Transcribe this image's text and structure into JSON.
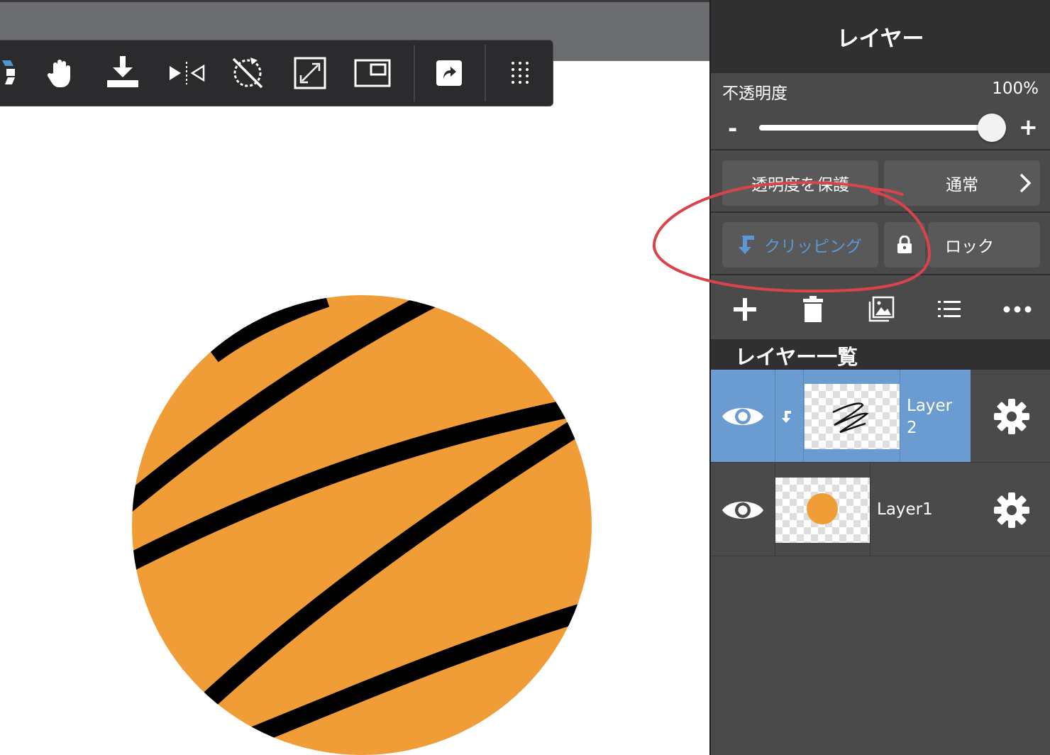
{
  "canvas": {
    "fill_color": "#f09d38",
    "stroke_color": "#000000",
    "background": "#ffffff"
  },
  "toolbar": {
    "tools": [
      {
        "name": "eraser-icon"
      },
      {
        "name": "hand-icon"
      },
      {
        "name": "import-icon"
      },
      {
        "name": "flip-icon"
      },
      {
        "name": "rotate-off-icon"
      },
      {
        "name": "fullscreen-icon"
      },
      {
        "name": "window-icon"
      },
      {
        "name": "share-icon"
      },
      {
        "name": "grid-menu-icon"
      }
    ]
  },
  "layer_panel": {
    "title": "レイヤー",
    "opacity_label": "不透明度",
    "opacity_value": "100%",
    "opacity_fraction": 1.0,
    "minus_label": "-",
    "plus_label": "+",
    "protect_alpha_label": "透明度を保護",
    "blend_mode_label": "通常",
    "clipping_label": "クリッピング",
    "lock_label": "ロック",
    "actions": [
      "add-icon",
      "trash-icon",
      "image-icon",
      "list-icon",
      "more-icon"
    ],
    "list_title": "レイヤー一覧",
    "layers": [
      {
        "name": "Layer\n2",
        "selected": true,
        "clipped": true
      },
      {
        "name": "Layer1",
        "selected": false,
        "clipped": false
      }
    ],
    "accent_color": "#6a9cd1",
    "annotation_color": "#d9434b"
  }
}
